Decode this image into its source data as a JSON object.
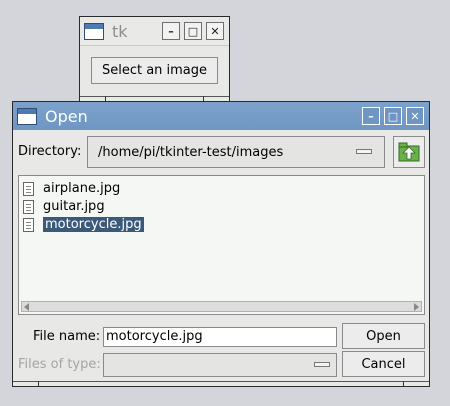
{
  "tk_window": {
    "title": "tk",
    "select_button": "Select an image"
  },
  "dialog": {
    "title": "Open",
    "directory_label": "Directory:",
    "directory_value": "/home/pi/tkinter-test/images",
    "files": [
      {
        "name": "airplane.jpg",
        "selected": false
      },
      {
        "name": "guitar.jpg",
        "selected": false
      },
      {
        "name": "motorcycle.jpg",
        "selected": true
      }
    ],
    "file_name_label": "File name:",
    "file_name_value": "motorcycle.jpg",
    "files_of_type_label": "Files of type:",
    "files_of_type_value": "",
    "open_button": "Open",
    "cancel_button": "Cancel"
  },
  "window_controls": {
    "minimize": "–",
    "maximize": "□",
    "close": "✕"
  },
  "colors": {
    "desktop": "#d4d4db",
    "dialog_titlebar": "#6f95c2",
    "selection": "#3b5a7a"
  }
}
